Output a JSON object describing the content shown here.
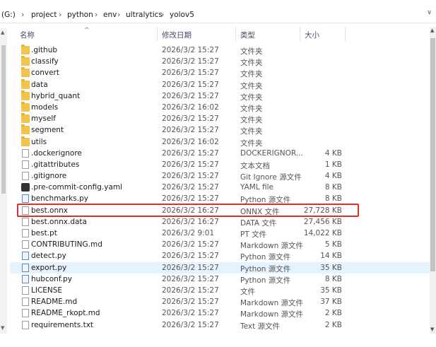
{
  "address": {
    "segments": [
      "(G:)",
      "project",
      "python",
      "env",
      "ultralytics",
      "yolov5"
    ]
  },
  "columns": {
    "name": "名称",
    "date": "修改日期",
    "type": "类型",
    "size": "大小"
  },
  "files": [
    {
      "name": ".github",
      "date": "2026/3/2 15:27",
      "type": "文件夹",
      "size": "",
      "icon": "folder"
    },
    {
      "name": "classify",
      "date": "2026/3/2 15:27",
      "type": "文件夹",
      "size": "",
      "icon": "folder"
    },
    {
      "name": "convert",
      "date": "2026/3/2 15:27",
      "type": "文件夹",
      "size": "",
      "icon": "folder"
    },
    {
      "name": "data",
      "date": "2026/3/2 15:27",
      "type": "文件夹",
      "size": "",
      "icon": "folder"
    },
    {
      "name": "hybrid_quant",
      "date": "2026/3/2 15:27",
      "type": "文件夹",
      "size": "",
      "icon": "folder"
    },
    {
      "name": "models",
      "date": "2026/3/2 16:02",
      "type": "文件夹",
      "size": "",
      "icon": "folder"
    },
    {
      "name": "myself",
      "date": "2026/3/2 15:27",
      "type": "文件夹",
      "size": "",
      "icon": "folder"
    },
    {
      "name": "segment",
      "date": "2026/3/2 15:27",
      "type": "文件夹",
      "size": "",
      "icon": "folder"
    },
    {
      "name": "utils",
      "date": "2026/3/2 16:02",
      "type": "文件夹",
      "size": "",
      "icon": "folder"
    },
    {
      "name": ".dockerignore",
      "date": "2026/3/2 15:27",
      "type": "DOCKERIGNOR...",
      "size": "4 KB",
      "icon": "doc"
    },
    {
      "name": ".gitattributes",
      "date": "2026/3/2 15:27",
      "type": "文本文档",
      "size": "1 KB",
      "icon": "doc"
    },
    {
      "name": ".gitignore",
      "date": "2026/3/2 15:27",
      "type": "Git Ignore 源文件",
      "size": "4 KB",
      "icon": "doc"
    },
    {
      "name": ".pre-commit-config.yaml",
      "date": "2026/3/2 15:27",
      "type": "YAML file",
      "size": "8 KB",
      "icon": "yml"
    },
    {
      "name": "benchmarks.py",
      "date": "2026/3/2 15:27",
      "type": "Python 源文件",
      "size": "8 KB",
      "icon": "py"
    },
    {
      "name": "best.onnx",
      "date": "2026/3/2 16:27",
      "type": "ONNX 文件",
      "size": "27,728 KB",
      "icon": "doc"
    },
    {
      "name": "best.onnx.data",
      "date": "2026/3/2 16:27",
      "type": "DATA 文件",
      "size": "27,456 KB",
      "icon": "doc"
    },
    {
      "name": "best.pt",
      "date": "2026/3/2 9:01",
      "type": "PT 文件",
      "size": "14,022 KB",
      "icon": "doc"
    },
    {
      "name": "CONTRIBUTING.md",
      "date": "2026/3/2 15:27",
      "type": "Markdown 源文件",
      "size": "5 KB",
      "icon": "doc"
    },
    {
      "name": "detect.py",
      "date": "2026/3/2 15:27",
      "type": "Python 源文件",
      "size": "14 KB",
      "icon": "py"
    },
    {
      "name": "export.py",
      "date": "2026/3/2 15:27",
      "type": "Python 源文件",
      "size": "35 KB",
      "icon": "py"
    },
    {
      "name": "hubconf.py",
      "date": "2026/3/2 15:27",
      "type": "Python 源文件",
      "size": "8 KB",
      "icon": "py"
    },
    {
      "name": "LICENSE",
      "date": "2026/3/2 15:27",
      "type": "文件",
      "size": "35 KB",
      "icon": "doc"
    },
    {
      "name": "README.md",
      "date": "2026/3/2 15:27",
      "type": "Markdown 源文件",
      "size": "37 KB",
      "icon": "doc"
    },
    {
      "name": "README_rkopt.md",
      "date": "2026/3/2 15:27",
      "type": "Markdown 源文件",
      "size": "2 KB",
      "icon": "doc"
    },
    {
      "name": "requirements.txt",
      "date": "2026/3/2 15:27",
      "type": "Text 源文件",
      "size": "2 KB",
      "icon": "doc"
    }
  ],
  "highlighted_index": 19,
  "annotated_index": 14,
  "colors": {
    "annotation": "#d9322e",
    "hover": "#e5f3ff",
    "folder": "#f3c44d"
  }
}
